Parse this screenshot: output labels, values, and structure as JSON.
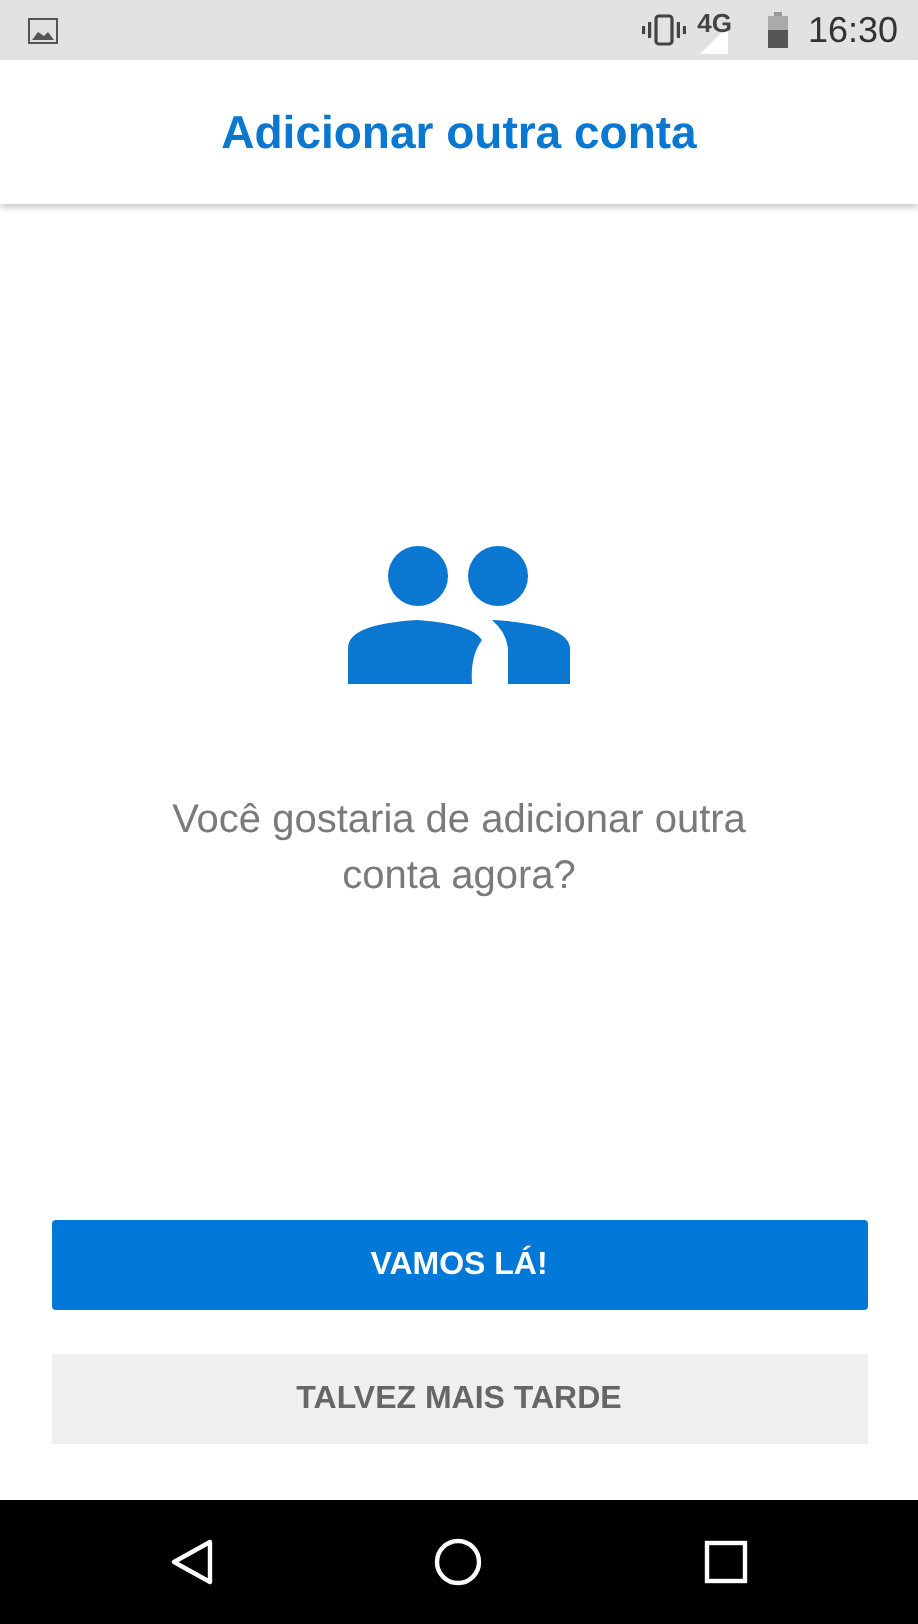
{
  "status_bar": {
    "network": "4G",
    "time": "16:30"
  },
  "header": {
    "title": "Adicionar outra conta"
  },
  "message": "Você gostaria de adicionar outra conta agora?",
  "buttons": [
    {
      "label": "VAMOS LÁ!",
      "kind": "primary"
    },
    {
      "label": "TALVEZ MAIS TARDE",
      "kind": "secondary"
    }
  ]
}
